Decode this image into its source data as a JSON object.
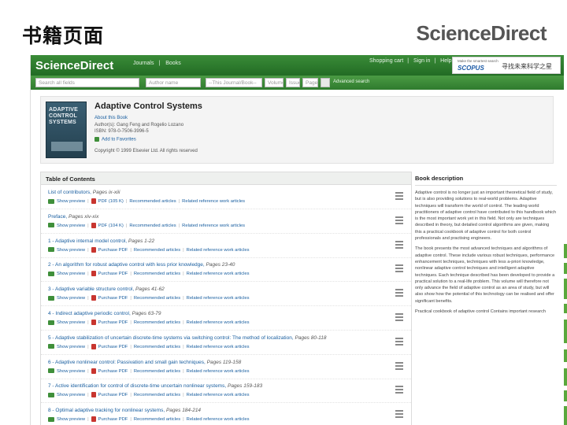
{
  "slide": {
    "title": "书籍页面",
    "logo": "ScienceDirect",
    "accent_color": "#5aa83c"
  },
  "topbar": {
    "logo": "ScienceDirect",
    "nav": [
      "Journals",
      "Books"
    ],
    "util": [
      "Shopping cart",
      "Sign in",
      "Help"
    ],
    "scopus_tagline": "Make the smartest search",
    "scopus_brand": "SCOPUS",
    "scopus_cn": "寻找未来科学之星"
  },
  "search": {
    "fields": [
      "Search all fields",
      "Author name",
      "--This Journal/Book--",
      "Volume",
      "Issue",
      "Page"
    ],
    "advanced": "Advanced search"
  },
  "book": {
    "cover_title": "ADAPTIVE CONTROL SYSTEMS",
    "title": "Adaptive Control Systems",
    "about": "About this Book",
    "authors": "Author(s): Gang Feng and Rogelio Lozano",
    "isbn": "ISBN: 978-0-7506-3996-5",
    "favorites": "Add to Favorites",
    "copyright": "Copyright © 1999 Elsevier Ltd. All rights reserved"
  },
  "toc": {
    "header": "Table of Contents",
    "rows": [
      {
        "title": "List of contributors",
        "pages": "Pages ix-xiii",
        "pdf": "PDF (105 K)"
      },
      {
        "title": "Preface",
        "pages": "Pages xiv-xix",
        "pdf": "PDF (104 K)"
      },
      {
        "title": "1 - Adaptive internal model control",
        "pages": "Pages 1-22",
        "pdf": "Purchase PDF"
      },
      {
        "title": "2 - An algorithm for robust adaptive control with less prior knowledge",
        "pages": "Pages 23-40",
        "pdf": "Purchase PDF"
      },
      {
        "title": "3 - Adaptive variable structure control",
        "pages": "Pages 41-62",
        "pdf": "Purchase PDF"
      },
      {
        "title": "4 - Indirect adaptive periodic control",
        "pages": "Pages 63-79",
        "pdf": "Purchase PDF"
      },
      {
        "title": "5 - Adaptive stabilization of uncertain discrete-time systems via switching control: The method of localization",
        "pages": "Pages 80-118",
        "pdf": "Purchase PDF"
      },
      {
        "title": "6 - Adaptive nonlinear control: Passivation and small gain techniques",
        "pages": "Pages 119-158",
        "pdf": "Purchase PDF"
      },
      {
        "title": "7 - Active identification for control of discrete-time uncertain nonlinear systems",
        "pages": "Pages 159-183",
        "pdf": "Purchase PDF"
      },
      {
        "title": "8 - Optimal adaptive tracking for nonlinear systems",
        "pages": "Pages 184-214",
        "pdf": "Purchase PDF"
      }
    ],
    "show_preview": "Show preview",
    "recommended": "Recommended articles",
    "related": "Related reference work articles"
  },
  "description": {
    "header": "Book description",
    "paragraphs": [
      "Adaptive control is no longer just an important theoretical field of study, but is also providing solutions to real-world problems. Adaptive techniques will transform the world of control. The leading world practitioners of adaptive control have contributed to this handbook which is the most important work yet in this field. Not only are techniques described in theory, but detailed control algorithms are given, making this a practical cookbook of adaptive control for both control professionals and practising engineers.",
      "The book presents the most advanced techniques and algorithms of adaptive control. These include various robust techniques, performance enhancement techniques, techniques with less a-priori knowledge, nonlinear adaptive control techniques and intelligent adaptive techniques. Each technique described has been developed to provide a practical solution to a real-life problem. This volume will therefore not only advance the field of adaptive control as an area of study, but will also show how the potential of this technology can be realised and offer significant benefits.",
      "Practical cookbook of adaptive control Contains important research"
    ]
  }
}
